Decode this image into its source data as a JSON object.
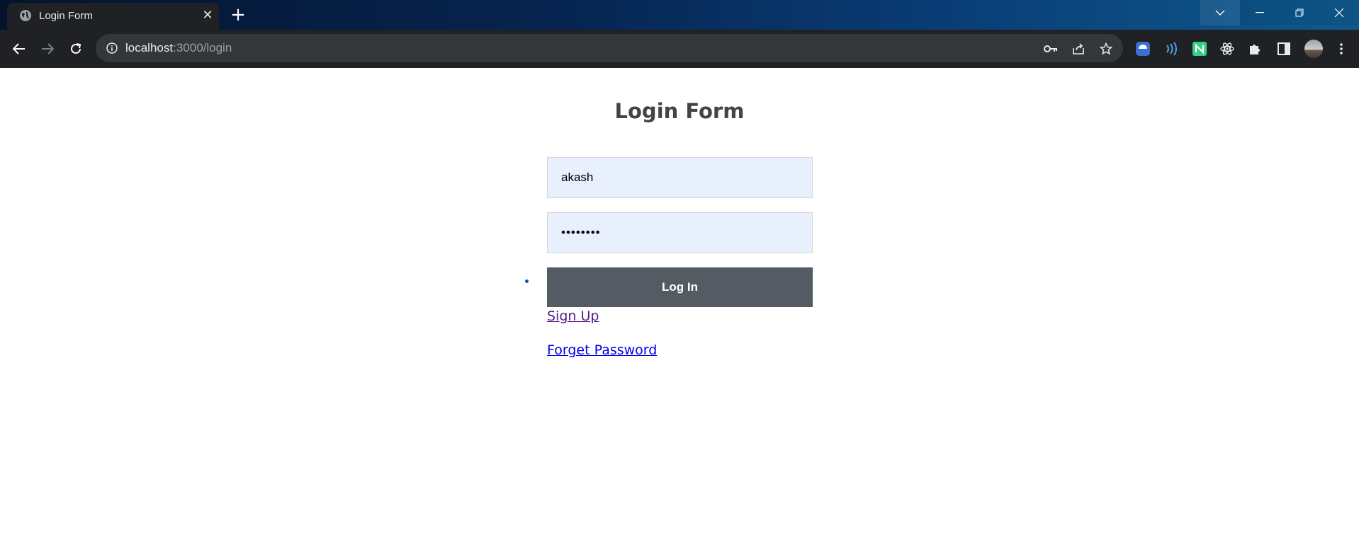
{
  "browser": {
    "tab": {
      "title": "Login Form"
    },
    "url": {
      "host": "localhost",
      "path": ":3000/login"
    }
  },
  "page": {
    "heading": "Login Form",
    "username": {
      "value": "akash"
    },
    "password": {
      "value": "••••••••"
    },
    "login_button": "Log In",
    "signup_link": "Sign Up",
    "forgot_link": "Forget Password"
  },
  "colors": {
    "button": "#545b62",
    "input_bg": "#e8f0fe",
    "link_visited": "#551a8b",
    "link": "#0000ee"
  }
}
